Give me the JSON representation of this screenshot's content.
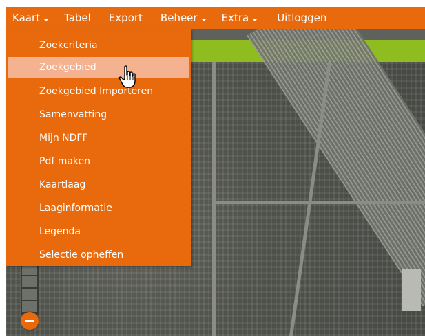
{
  "menubar": {
    "items": [
      {
        "label": "Kaart",
        "dropdown": true
      },
      {
        "label": "Tabel",
        "dropdown": false
      },
      {
        "label": "Export",
        "dropdown": false
      },
      {
        "label": "Beheer",
        "dropdown": true
      },
      {
        "label": "Extra",
        "dropdown": true
      },
      {
        "label": "Uitloggen",
        "dropdown": false
      }
    ]
  },
  "dropdown": {
    "items": [
      "Zoekcriteria",
      "Zoekgebied",
      "Zoekgebied Importeren",
      "Samenvatting",
      "Mijn NDFF",
      "Pdf maken",
      "Kaartlaag",
      "Laaginformatie",
      "Legenda",
      "Selectie opheffen"
    ],
    "hovered_index": 1
  },
  "icons": {
    "caret": "chevron-down-icon",
    "cursor": "hand-pointer-icon",
    "zoom_out": "minus-icon"
  },
  "colors": {
    "accent": "#e96a0d",
    "hover": "#f4b291",
    "green_bar": "#8fbd1f"
  }
}
